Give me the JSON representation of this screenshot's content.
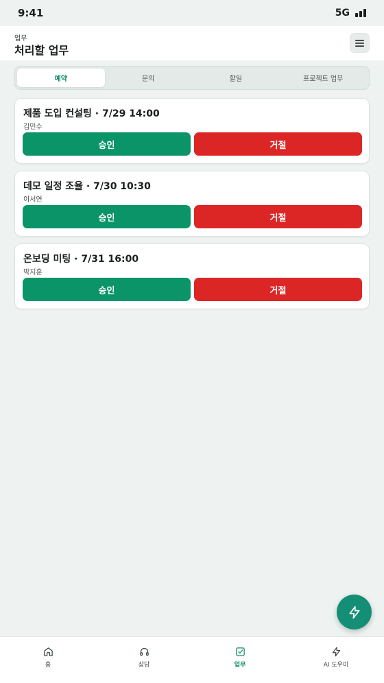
{
  "status_bar": {
    "time": "9:41",
    "network": "5G"
  },
  "header": {
    "section": "업무",
    "title": "처리할 업무"
  },
  "tabs": [
    {
      "label": "예약",
      "active": true
    },
    {
      "label": "문의",
      "active": false
    },
    {
      "label": "할일",
      "active": false
    },
    {
      "label": "프로젝트 업무",
      "active": false
    }
  ],
  "cards": [
    {
      "title": "제품 도입 컨설팅 · 7/29 14:00",
      "person": "김민수",
      "approve": "승인",
      "reject": "거절"
    },
    {
      "title": "데모 일정 조율 · 7/30 10:30",
      "person": "이서연",
      "approve": "승인",
      "reject": "거절"
    },
    {
      "title": "온보딩 미팅 · 7/31 16:00",
      "person": "박지훈",
      "approve": "승인",
      "reject": "거절"
    }
  ],
  "bottom_nav": [
    {
      "label": "홈",
      "icon": "home-icon"
    },
    {
      "label": "상담",
      "icon": "headphones-icon"
    },
    {
      "label": "업무",
      "icon": "task-check-icon",
      "active": true
    },
    {
      "label": "AI 도우미",
      "icon": "lightning-icon"
    }
  ],
  "colors": {
    "accent": "#0f8a67",
    "approve": "#0a9467",
    "reject": "#dc2626",
    "fab": "#148f76",
    "background": "#eef2f1"
  }
}
